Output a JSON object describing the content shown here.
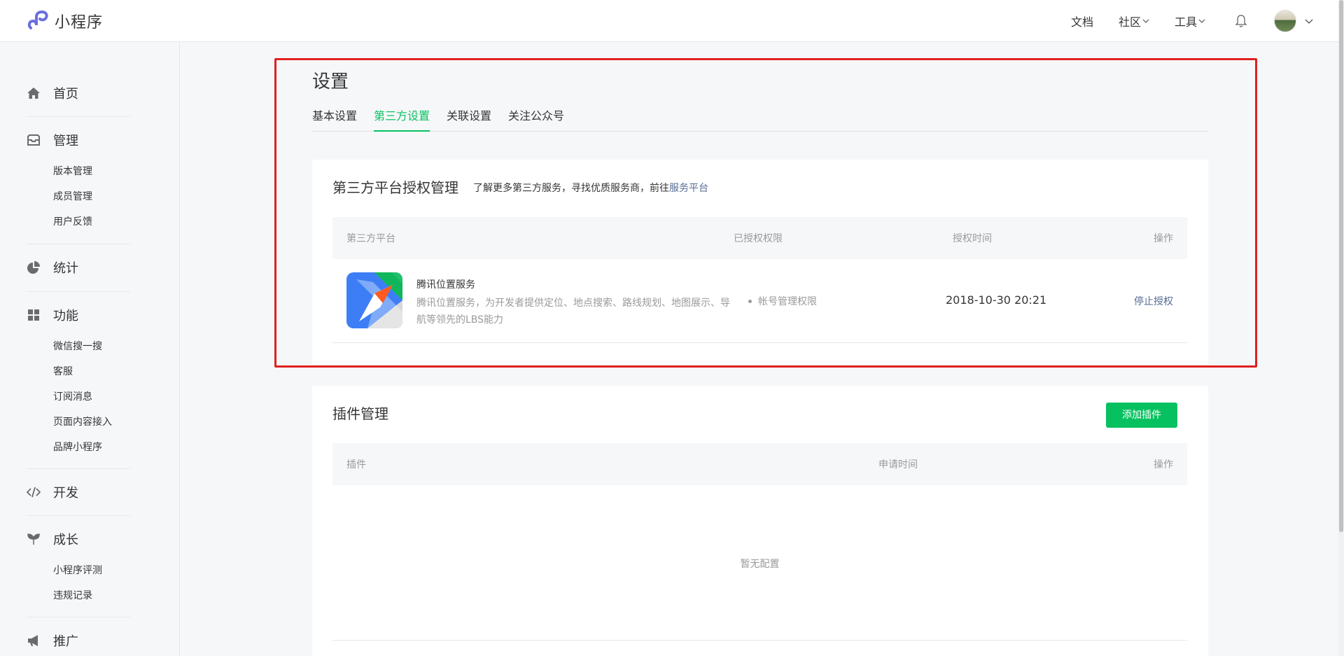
{
  "app": {
    "title": "小程序"
  },
  "topnav": {
    "docs": "文档",
    "community": "社区",
    "tools": "工具"
  },
  "sidebar": {
    "home": "首页",
    "manage": {
      "label": "管理",
      "items": [
        "版本管理",
        "成员管理",
        "用户反馈"
      ]
    },
    "stats": "统计",
    "features": {
      "label": "功能",
      "items": [
        "微信搜一搜",
        "客服",
        "订阅消息",
        "页面内容接入",
        "品牌小程序"
      ]
    },
    "dev": "开发",
    "growth": {
      "label": "成长",
      "items": [
        "小程序评测",
        "违规记录"
      ]
    },
    "promo": "推广"
  },
  "page": {
    "title": "设置",
    "tabs": [
      "基本设置",
      "第三方设置",
      "关联设置",
      "关注公众号"
    ],
    "active_tab": "第三方设置"
  },
  "third_party": {
    "title": "第三方平台授权管理",
    "desc_prefix": "了解更多第三方服务，寻找优质服务商，前往",
    "desc_link": "服务平台",
    "columns": [
      "第三方平台",
      "已授权权限",
      "授权时间",
      "操作"
    ],
    "rows": [
      {
        "name": "腾讯位置服务",
        "desc": "腾讯位置服务，为开发者提供定位、地点搜索、路线规划、地图展示、导航等领先的LBS能力",
        "permission": "帐号管理权限",
        "time": "2018-10-30 20:21",
        "action": "停止授权"
      }
    ]
  },
  "plugins": {
    "title": "插件管理",
    "add_button": "添加插件",
    "columns": [
      "插件",
      "申请时间",
      "操作"
    ],
    "empty": "暂无配置"
  },
  "colors": {
    "accent": "#07c160",
    "link": "#576b95",
    "highlight": "#e02020"
  }
}
